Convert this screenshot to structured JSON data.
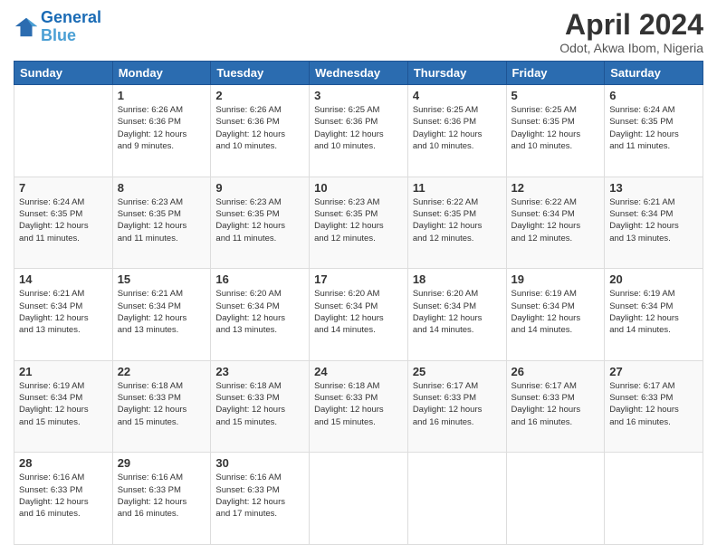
{
  "logo": {
    "line1": "General",
    "line2": "Blue"
  },
  "header": {
    "month": "April 2024",
    "location": "Odot, Akwa Ibom, Nigeria"
  },
  "weekdays": [
    "Sunday",
    "Monday",
    "Tuesday",
    "Wednesday",
    "Thursday",
    "Friday",
    "Saturday"
  ],
  "weeks": [
    [
      {
        "day": "",
        "info": ""
      },
      {
        "day": "1",
        "info": "Sunrise: 6:26 AM\nSunset: 6:36 PM\nDaylight: 12 hours\nand 9 minutes."
      },
      {
        "day": "2",
        "info": "Sunrise: 6:26 AM\nSunset: 6:36 PM\nDaylight: 12 hours\nand 10 minutes."
      },
      {
        "day": "3",
        "info": "Sunrise: 6:25 AM\nSunset: 6:36 PM\nDaylight: 12 hours\nand 10 minutes."
      },
      {
        "day": "4",
        "info": "Sunrise: 6:25 AM\nSunset: 6:36 PM\nDaylight: 12 hours\nand 10 minutes."
      },
      {
        "day": "5",
        "info": "Sunrise: 6:25 AM\nSunset: 6:35 PM\nDaylight: 12 hours\nand 10 minutes."
      },
      {
        "day": "6",
        "info": "Sunrise: 6:24 AM\nSunset: 6:35 PM\nDaylight: 12 hours\nand 11 minutes."
      }
    ],
    [
      {
        "day": "7",
        "info": "Sunrise: 6:24 AM\nSunset: 6:35 PM\nDaylight: 12 hours\nand 11 minutes."
      },
      {
        "day": "8",
        "info": "Sunrise: 6:23 AM\nSunset: 6:35 PM\nDaylight: 12 hours\nand 11 minutes."
      },
      {
        "day": "9",
        "info": "Sunrise: 6:23 AM\nSunset: 6:35 PM\nDaylight: 12 hours\nand 11 minutes."
      },
      {
        "day": "10",
        "info": "Sunrise: 6:23 AM\nSunset: 6:35 PM\nDaylight: 12 hours\nand 12 minutes."
      },
      {
        "day": "11",
        "info": "Sunrise: 6:22 AM\nSunset: 6:35 PM\nDaylight: 12 hours\nand 12 minutes."
      },
      {
        "day": "12",
        "info": "Sunrise: 6:22 AM\nSunset: 6:34 PM\nDaylight: 12 hours\nand 12 minutes."
      },
      {
        "day": "13",
        "info": "Sunrise: 6:21 AM\nSunset: 6:34 PM\nDaylight: 12 hours\nand 13 minutes."
      }
    ],
    [
      {
        "day": "14",
        "info": "Sunrise: 6:21 AM\nSunset: 6:34 PM\nDaylight: 12 hours\nand 13 minutes."
      },
      {
        "day": "15",
        "info": "Sunrise: 6:21 AM\nSunset: 6:34 PM\nDaylight: 12 hours\nand 13 minutes."
      },
      {
        "day": "16",
        "info": "Sunrise: 6:20 AM\nSunset: 6:34 PM\nDaylight: 12 hours\nand 13 minutes."
      },
      {
        "day": "17",
        "info": "Sunrise: 6:20 AM\nSunset: 6:34 PM\nDaylight: 12 hours\nand 14 minutes."
      },
      {
        "day": "18",
        "info": "Sunrise: 6:20 AM\nSunset: 6:34 PM\nDaylight: 12 hours\nand 14 minutes."
      },
      {
        "day": "19",
        "info": "Sunrise: 6:19 AM\nSunset: 6:34 PM\nDaylight: 12 hours\nand 14 minutes."
      },
      {
        "day": "20",
        "info": "Sunrise: 6:19 AM\nSunset: 6:34 PM\nDaylight: 12 hours\nand 14 minutes."
      }
    ],
    [
      {
        "day": "21",
        "info": "Sunrise: 6:19 AM\nSunset: 6:34 PM\nDaylight: 12 hours\nand 15 minutes."
      },
      {
        "day": "22",
        "info": "Sunrise: 6:18 AM\nSunset: 6:33 PM\nDaylight: 12 hours\nand 15 minutes."
      },
      {
        "day": "23",
        "info": "Sunrise: 6:18 AM\nSunset: 6:33 PM\nDaylight: 12 hours\nand 15 minutes."
      },
      {
        "day": "24",
        "info": "Sunrise: 6:18 AM\nSunset: 6:33 PM\nDaylight: 12 hours\nand 15 minutes."
      },
      {
        "day": "25",
        "info": "Sunrise: 6:17 AM\nSunset: 6:33 PM\nDaylight: 12 hours\nand 16 minutes."
      },
      {
        "day": "26",
        "info": "Sunrise: 6:17 AM\nSunset: 6:33 PM\nDaylight: 12 hours\nand 16 minutes."
      },
      {
        "day": "27",
        "info": "Sunrise: 6:17 AM\nSunset: 6:33 PM\nDaylight: 12 hours\nand 16 minutes."
      }
    ],
    [
      {
        "day": "28",
        "info": "Sunrise: 6:16 AM\nSunset: 6:33 PM\nDaylight: 12 hours\nand 16 minutes."
      },
      {
        "day": "29",
        "info": "Sunrise: 6:16 AM\nSunset: 6:33 PM\nDaylight: 12 hours\nand 16 minutes."
      },
      {
        "day": "30",
        "info": "Sunrise: 6:16 AM\nSunset: 6:33 PM\nDaylight: 12 hours\nand 17 minutes."
      },
      {
        "day": "",
        "info": ""
      },
      {
        "day": "",
        "info": ""
      },
      {
        "day": "",
        "info": ""
      },
      {
        "day": "",
        "info": ""
      }
    ]
  ]
}
